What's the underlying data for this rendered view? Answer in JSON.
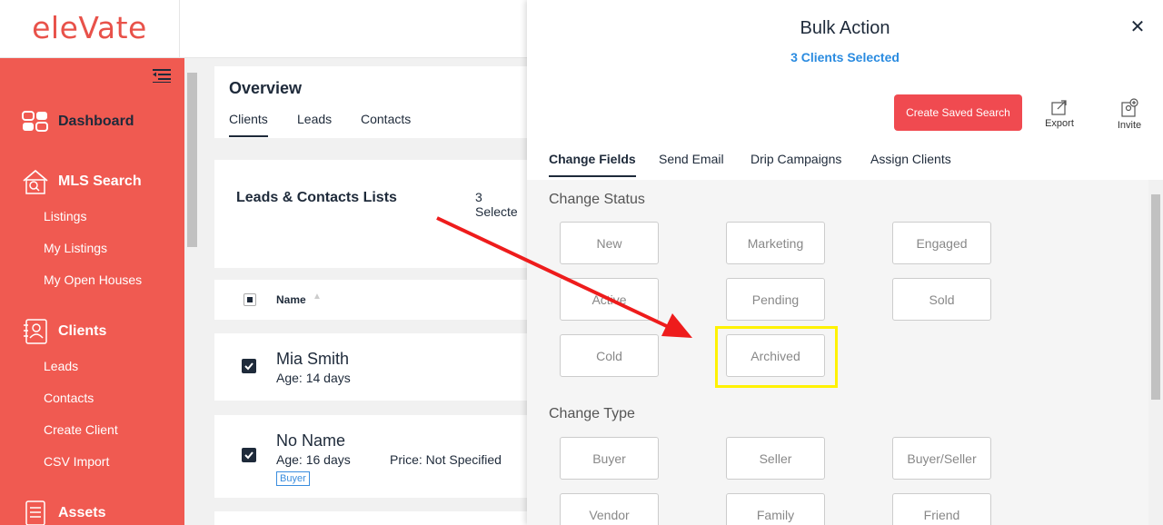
{
  "logo": "eleVate",
  "sidebar": {
    "dashboard": "Dashboard",
    "mls_search": "MLS Search",
    "mls_items": [
      "Listings",
      "My Listings",
      "My Open Houses"
    ],
    "clients": "Clients",
    "client_items": [
      "Leads",
      "Contacts",
      "Create Client",
      "CSV Import"
    ],
    "assets": "Assets"
  },
  "overview": {
    "title": "Overview",
    "tabs": [
      "Clients",
      "Leads",
      "Contacts"
    ]
  },
  "lists": {
    "title": "Leads & Contacts Lists",
    "selected": "3 Selecte",
    "name_header": "Name"
  },
  "rows": [
    {
      "name": "Mia Smith",
      "age": "Age: 14 days"
    },
    {
      "name": "No Name",
      "age": "Age: 16 days",
      "price": "Price: Not Specified",
      "tag": "Buyer"
    }
  ],
  "panel": {
    "title": "Bulk Action",
    "subtitle": "3 Clients Selected",
    "save_search": "Create Saved Search",
    "export": "Export",
    "invite": "Invite",
    "tabs": [
      "Change Fields",
      "Send Email",
      "Drip Campaigns",
      "Assign Clients"
    ],
    "status_label": "Change Status",
    "status_options": [
      "New",
      "Marketing",
      "Engaged",
      "Active",
      "Pending",
      "Sold",
      "Cold",
      "Archived"
    ],
    "type_label": "Change Type",
    "type_options": [
      "Buyer",
      "Seller",
      "Buyer/Seller",
      "Vendor",
      "Family",
      "Friend"
    ]
  },
  "colors": {
    "brand": "#f05a51",
    "accent_blue": "#2a8be0",
    "highlight": "#fff200",
    "arrow": "#ee1c1c"
  }
}
